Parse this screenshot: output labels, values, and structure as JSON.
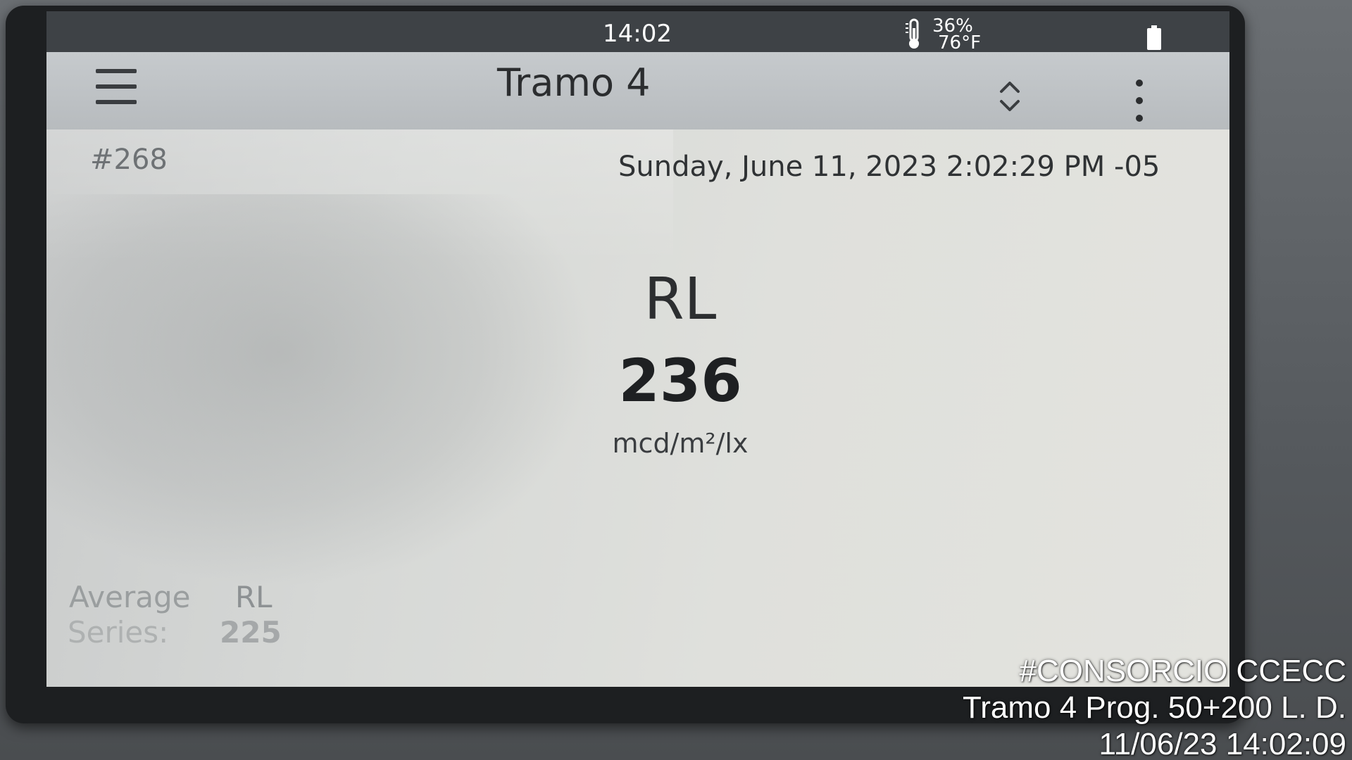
{
  "status_bar": {
    "time": "14:02",
    "humidity": "36%",
    "temperature": "76°F",
    "icons": [
      "thermometer-icon",
      "battery-icon"
    ]
  },
  "title_bar": {
    "title": "Tramo 4",
    "icons": [
      "menu-icon",
      "sort-updown-icon",
      "more-vert-icon"
    ]
  },
  "record": {
    "id": "#268",
    "datetime": "Sunday, June 11, 2023 2:02:29 PM -05"
  },
  "measurement": {
    "label": "RL",
    "value": "236",
    "unit": "mcd/m²/lx"
  },
  "summary": {
    "average_label": "Average",
    "average_metric": "RL",
    "series_label": "Series:",
    "series_value": "225"
  },
  "watermark": {
    "line1": "#CONSORCIO CCECC",
    "line2": "Tramo 4 Prog. 50+200 L. D.",
    "line3": "11/06/23  14:02:09"
  },
  "colors": {
    "status_bar": "#3e4246",
    "title_bar": "#c0c4c7",
    "screen": "#dcddd9",
    "text_dark": "#1e2022"
  }
}
